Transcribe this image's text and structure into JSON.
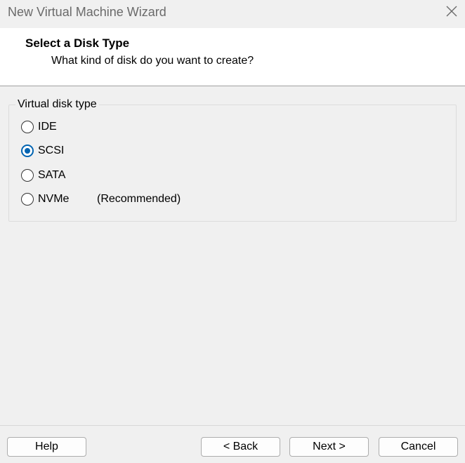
{
  "window": {
    "title": "New Virtual Machine Wizard",
    "close_icon": "close-icon"
  },
  "header": {
    "title": "Select a Disk Type",
    "subtitle": "What kind of disk do you want to create?"
  },
  "disk_type_group": {
    "legend": "Virtual disk type",
    "options": [
      {
        "label": "IDE",
        "selected": false,
        "note": ""
      },
      {
        "label": "SCSI",
        "selected": true,
        "note": ""
      },
      {
        "label": "SATA",
        "selected": false,
        "note": ""
      },
      {
        "label": "NVMe",
        "selected": false,
        "note": "(Recommended)"
      }
    ],
    "selected_value": "SCSI"
  },
  "buttons": {
    "help": "Help",
    "back": "< Back",
    "next": "Next >",
    "cancel": "Cancel"
  },
  "colors": {
    "accent": "#0063b1",
    "title_text": "#6a6a6a",
    "header_bg": "#ffffff",
    "body_bg": "#f0f0f0"
  }
}
